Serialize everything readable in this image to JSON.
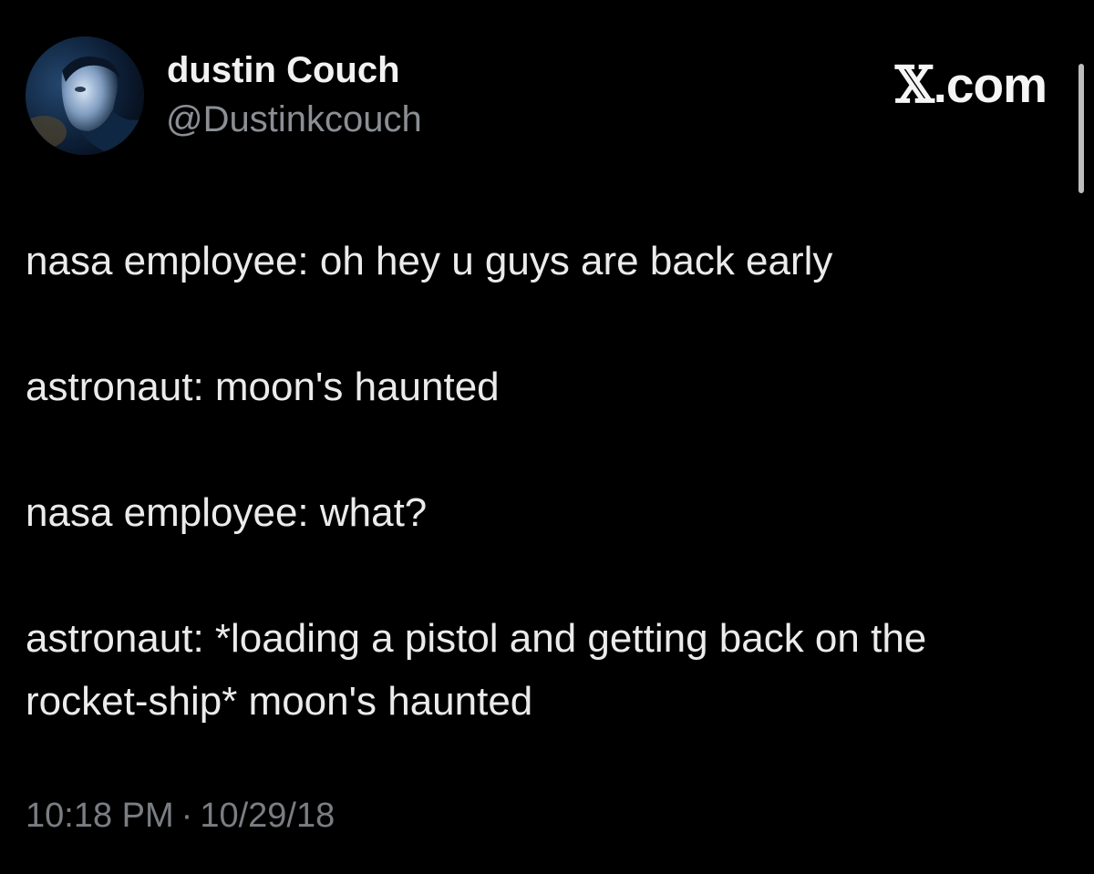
{
  "author": {
    "display_name": "dustin Couch",
    "handle": "@Dustinkcouch",
    "avatar_icon": "user-avatar-photo"
  },
  "brand": {
    "x_glyph": "𝕏",
    "suffix": ".com",
    "icon": "x-logo-icon"
  },
  "tweet": {
    "lines": [
      "nasa employee: oh hey u guys are back early",
      "astronaut: moon's haunted",
      "nasa employee: what?",
      "astronaut: *loading a pistol and getting back on the rocket-ship* moon's haunted"
    ],
    "time": "10:18 PM",
    "separator": "·",
    "date": "10/29/18"
  },
  "colors": {
    "background": "#000000",
    "primary_text": "#ebebeb",
    "secondary_text": "#8b8f94"
  }
}
